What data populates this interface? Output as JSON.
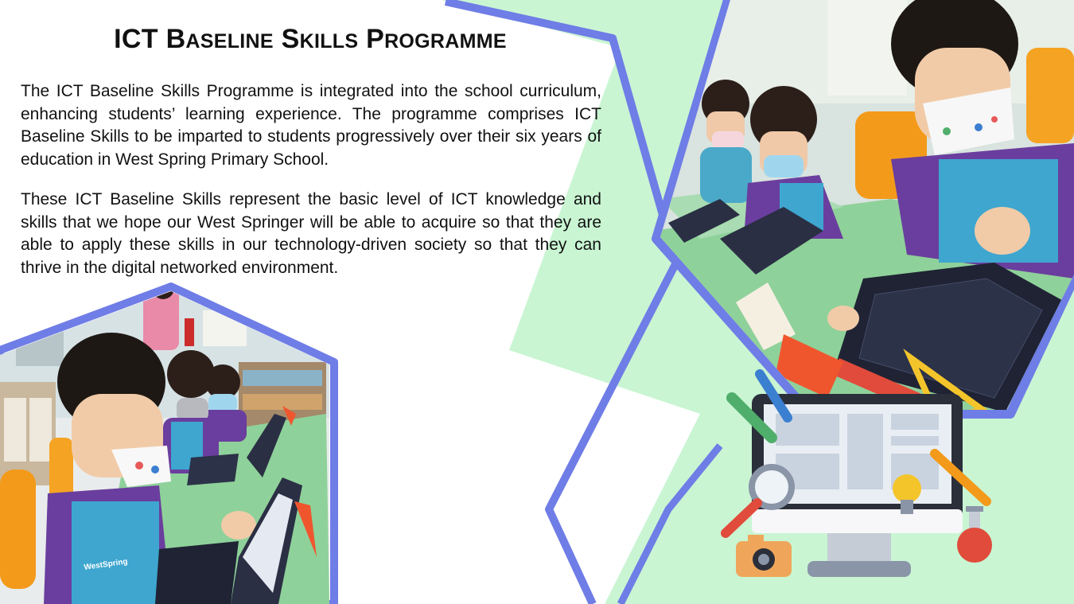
{
  "title": {
    "words": [
      {
        "cap": "ICT",
        "rest": ""
      },
      {
        "cap": "B",
        "rest": "ASELINE"
      },
      {
        "cap": "S",
        "rest": "KILLS"
      },
      {
        "cap": "P",
        "rest": "ROGRAMME"
      }
    ]
  },
  "paragraphs": [
    "The ICT Baseline Skills Programme is integrated into the school curriculum, enhancing students’ learning experience. The programme comprises ICT Baseline Skills to be imparted to students progressively over their six years of education in West Spring Primary School.",
    "These ICT Baseline Skills represent the basic level of ICT knowledge and skills that we hope our West Springer will be able to acquire so that they are able to apply these skills in our technology-driven society so that they can thrive in the digital networked environment."
  ],
  "photo_left": {
    "uniform_text": "WestSpring"
  },
  "colors": {
    "accent_blue": "#6f7de6",
    "mint_green": "#c9f5d3",
    "desk_green": "#8fd19a",
    "uniform_purple": "#6a3e9e",
    "chair_orange": "#f39a1a"
  }
}
